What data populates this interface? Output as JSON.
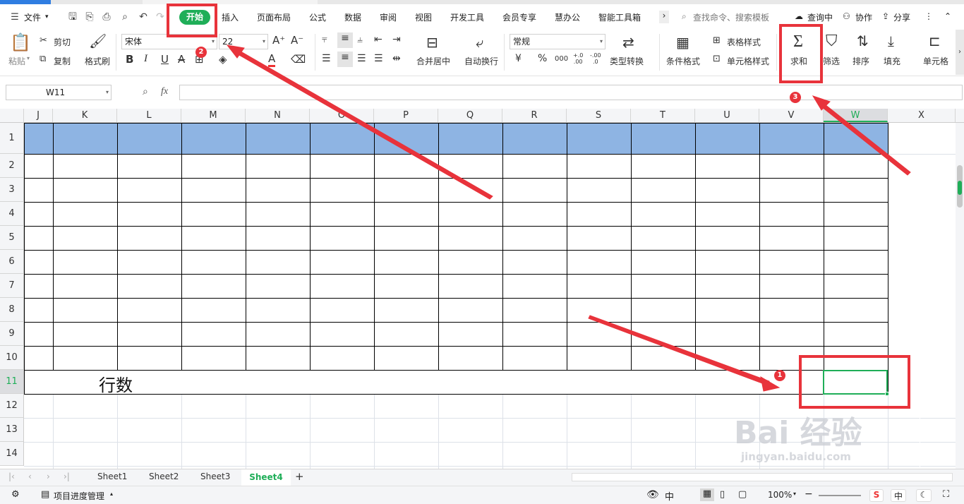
{
  "menubar": {
    "file_label": "文件",
    "tabs": [
      {
        "label": "开始",
        "active": true
      },
      {
        "label": "插入"
      },
      {
        "label": "页面布局"
      },
      {
        "label": "公式"
      },
      {
        "label": "数据"
      },
      {
        "label": "审阅"
      },
      {
        "label": "视图"
      },
      {
        "label": "开发工具"
      },
      {
        "label": "会员专享"
      },
      {
        "label": "慧办公"
      },
      {
        "label": "智能工具箱"
      }
    ],
    "search_placeholder": "查找命令、搜索模板",
    "right_items": [
      "查询中",
      "协作",
      "分享"
    ],
    "more_glyph": "›"
  },
  "ribbon": {
    "paste": "粘贴",
    "cut": "剪切",
    "copy": "复制",
    "format_painter": "格式刷",
    "font_name": "宋体",
    "font_size": "22",
    "font_grow": "A⁺",
    "font_shrink": "A⁻",
    "bold": "B",
    "italic": "I",
    "underline": "U",
    "strike": "A",
    "font_color": "A",
    "merge_center": "合并居中",
    "wrap_text": "自动换行",
    "number_format": "常规",
    "currency": "¥",
    "percent": "%",
    "thousands": "000",
    "inc_decimal": "+.0\n.00",
    "dec_decimal": "-.00\n.0",
    "type_convert": "类型转换",
    "cond_format": "条件格式",
    "table_style": "表格样式",
    "cell_style": "单元格样式",
    "sum": "求和",
    "filter": "筛选",
    "sort": "排序",
    "fill": "填充",
    "cell": "单元格"
  },
  "formula_bar": {
    "name_box": "W11",
    "fx": "fx",
    "formula": ""
  },
  "columns": [
    "J",
    "K",
    "L",
    "M",
    "N",
    "O",
    "P",
    "Q",
    "R",
    "S",
    "T",
    "U",
    "V",
    "W",
    "X"
  ],
  "rows": [
    "1",
    "2",
    "3",
    "4",
    "5",
    "6",
    "7",
    "8",
    "9",
    "10",
    "11",
    "12",
    "13",
    "14"
  ],
  "selected_cell": "W11",
  "cells": {
    "K11": "行数"
  },
  "sheets": [
    {
      "name": "Sheet1"
    },
    {
      "name": "Sheet2"
    },
    {
      "name": "Sheet3"
    },
    {
      "name": "Sheet4",
      "active": true
    }
  ],
  "status": {
    "project_label": "项目进度管理",
    "zoom": "100%",
    "ime": "中"
  },
  "annotations": [
    {
      "number": "1"
    },
    {
      "number": "2"
    },
    {
      "number": "3"
    }
  ],
  "watermark": {
    "text": "Bai 经验",
    "url": "jingyan.baidu.com"
  },
  "colors": {
    "accent": "#1fae58",
    "header_fill": "#8eb4e3",
    "annotation": "#e8333b",
    "selection": "#1fae58"
  }
}
